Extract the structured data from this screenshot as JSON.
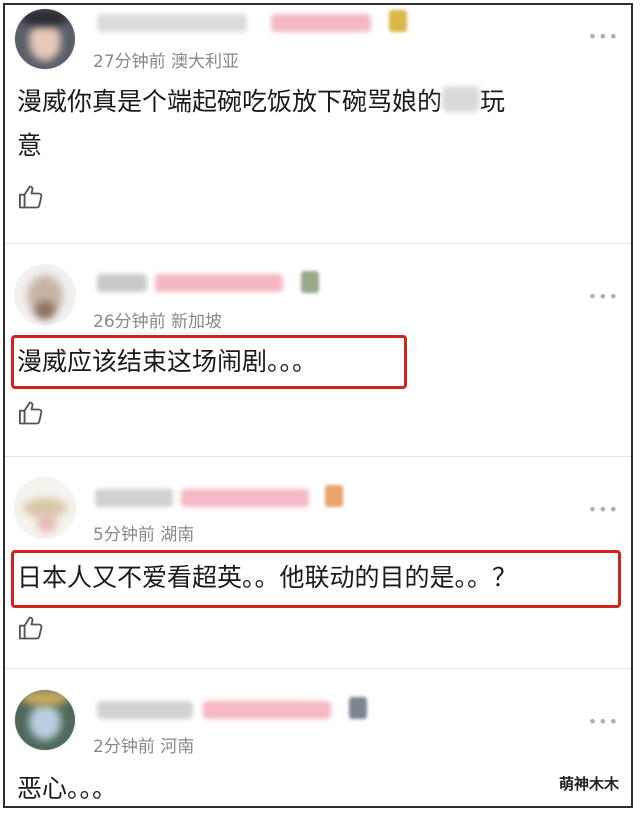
{
  "comments": [
    {
      "time": "27分钟前",
      "location": "澳大利亚",
      "text_line1_a": "漫威你真是个端起碗吃饭放下碗骂娘的",
      "text_line1_b": "玩",
      "text_line2": "意",
      "more": "•••"
    },
    {
      "time": "26分钟前",
      "location": "新加坡",
      "text": "漫威应该结束这场闹剧。。。",
      "more": "•••"
    },
    {
      "time": "5分钟前",
      "location": "湖南",
      "text": "日本人又不爱看超英。。他联动的目的是。。？",
      "more": "•••"
    },
    {
      "time": "2分钟前",
      "location": "河南",
      "text": "恶心。。。",
      "more": "•••"
    }
  ],
  "icons": {
    "like": "thumbs-up-icon",
    "more": "more-dots-icon"
  },
  "colors": {
    "highlight_box": "#d42222",
    "meta_text": "#888888",
    "divider": "#e3e3e3"
  },
  "watermark": "萌神木木"
}
